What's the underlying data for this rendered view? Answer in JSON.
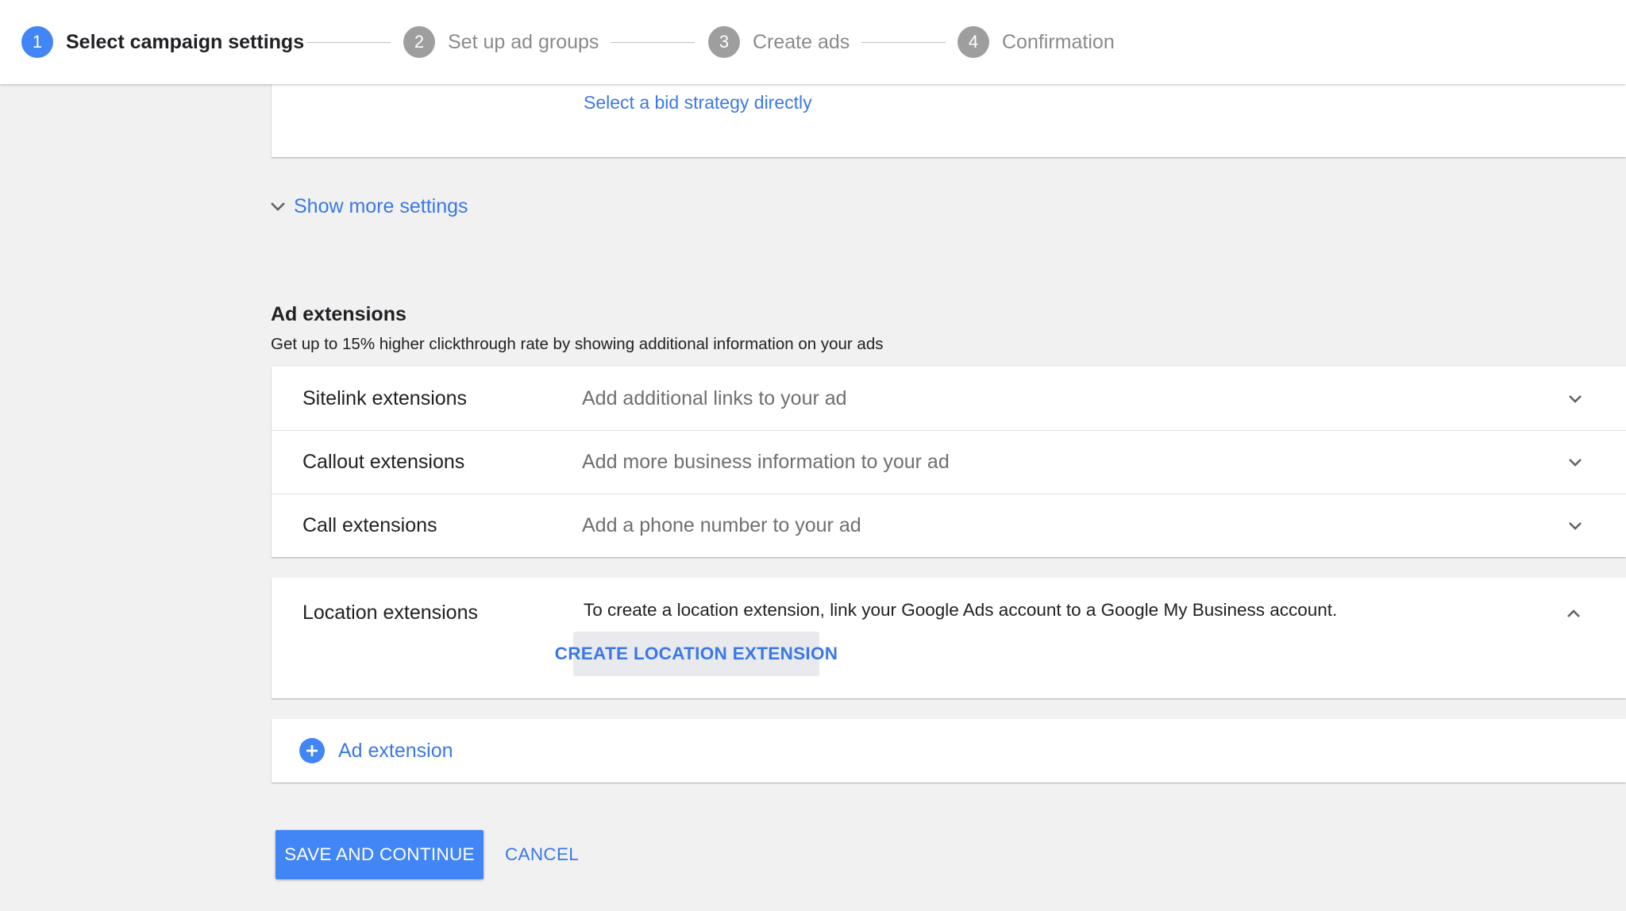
{
  "stepper": {
    "steps": [
      {
        "number": "1",
        "label": "Select campaign settings",
        "state": "active"
      },
      {
        "number": "2",
        "label": "Set up ad groups",
        "state": "inactive"
      },
      {
        "number": "3",
        "label": "Create ads",
        "state": "inactive"
      },
      {
        "number": "4",
        "label": "Confirmation",
        "state": "inactive"
      }
    ]
  },
  "bidding": {
    "link_label": "Select a bid strategy directly"
  },
  "show_more": {
    "label": "Show more settings",
    "icon": "chevron-down-icon"
  },
  "ad_extensions": {
    "title": "Ad extensions",
    "subtitle": "Get up to 15% higher clickthrough rate by showing additional information on your ads",
    "items": [
      {
        "name": "Sitelink extensions",
        "description": "Add additional links to your ad",
        "icon": "chevron-down-icon"
      },
      {
        "name": "Callout extensions",
        "description": "Add more business information to your ad",
        "icon": "chevron-down-icon"
      },
      {
        "name": "Call extensions",
        "description": "Add a phone number to your ad",
        "icon": "chevron-down-icon"
      }
    ],
    "location": {
      "name": "Location extensions",
      "message": "To create a location extension, link your Google Ads account to a Google My Business account.",
      "button_label": "CREATE LOCATION EXTENSION",
      "icon": "chevron-up-icon"
    },
    "add_button": {
      "label": "Ad extension",
      "icon": "add-circle-icon"
    }
  },
  "actions": {
    "save_label": "SAVE AND CONTINUE",
    "cancel_label": "CANCEL"
  },
  "colors": {
    "accent": "#4285f4",
    "link": "#3b78e7",
    "inactive_step": "#9e9e9e",
    "background": "#f1f1f1"
  }
}
